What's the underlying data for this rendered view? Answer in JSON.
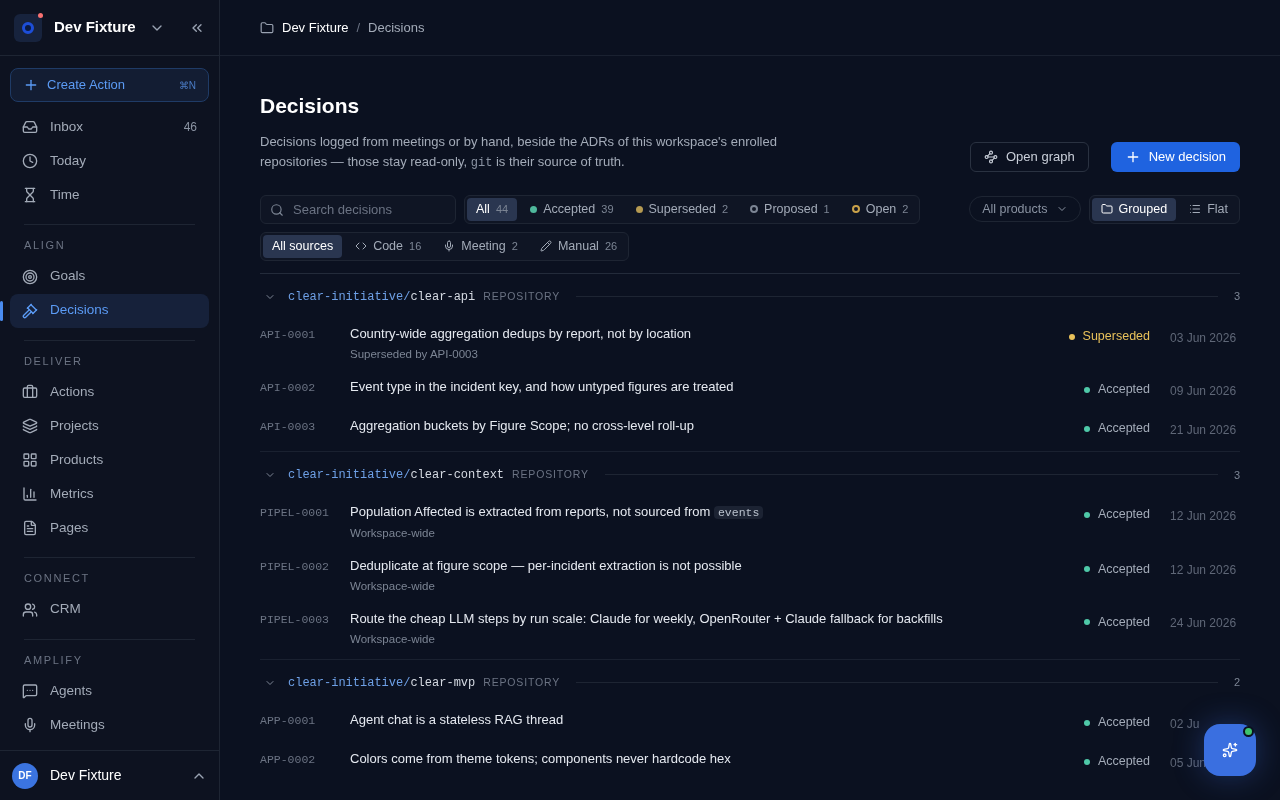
{
  "workspace": {
    "name": "Dev Fixture",
    "notification": true
  },
  "create_button": {
    "label": "Create Action",
    "shortcut": "⌘N"
  },
  "nav_top": [
    {
      "label": "Inbox",
      "count": "46",
      "selected": false
    },
    {
      "label": "Today",
      "selected": false
    },
    {
      "label": "Time",
      "selected": false
    }
  ],
  "nav_sections": [
    {
      "title": "ALIGN",
      "items": [
        {
          "label": "Goals",
          "selected": false
        },
        {
          "label": "Decisions",
          "selected": true
        }
      ]
    },
    {
      "title": "DELIVER",
      "items": [
        {
          "label": "Actions",
          "selected": false
        },
        {
          "label": "Projects",
          "selected": false
        },
        {
          "label": "Products",
          "selected": false
        },
        {
          "label": "Metrics",
          "selected": false
        },
        {
          "label": "Pages",
          "selected": false
        }
      ]
    },
    {
      "title": "CONNECT",
      "items": [
        {
          "label": "CRM",
          "selected": false
        }
      ]
    },
    {
      "title": "AMPLIFY",
      "items": [
        {
          "label": "Agents",
          "selected": false
        },
        {
          "label": "Meetings",
          "selected": false
        }
      ]
    }
  ],
  "user": {
    "initials": "DF",
    "name": "Dev Fixture"
  },
  "breadcrumb": [
    "Dev Fixture",
    "Decisions"
  ],
  "breadcrumb_separator": "/",
  "page": {
    "title": "Decisions",
    "desc_before": "Decisions logged from meetings or by hand, beside the ADRs of this workspace's enrolled repositories — those stay read-only, ",
    "desc_code": "git",
    "desc_after": " is their source of truth."
  },
  "actions": [
    {
      "kind": "secondary",
      "label": "Open graph"
    },
    {
      "kind": "primary",
      "label": "New decision"
    }
  ],
  "search": {
    "placeholder": "Search decisions"
  },
  "status_filters": [
    {
      "label": "All",
      "count": "44",
      "selected": true
    },
    {
      "kind": "filled",
      "label": "Accepted",
      "count": "39",
      "selected": false,
      "color": "#4fb89c"
    },
    {
      "kind": "filled",
      "label": "Superseded",
      "count": "2",
      "selected": false,
      "color": "#b59a52"
    },
    {
      "kind": "ring",
      "label": "Proposed",
      "count": "1",
      "selected": false,
      "color": "#7c8594"
    },
    {
      "kind": "ring",
      "label": "Open",
      "count": "2",
      "selected": false,
      "color": "#c9a24a"
    }
  ],
  "product_select": {
    "value": "All products"
  },
  "view_toggle": [
    {
      "label": "Grouped",
      "selected": true
    },
    {
      "label": "Flat",
      "selected": false
    }
  ],
  "source_filters": [
    {
      "label": "All sources",
      "selected": true
    },
    {
      "label": "Code",
      "count": "16",
      "selected": false
    },
    {
      "label": "Meeting",
      "count": "2",
      "selected": false
    },
    {
      "label": "Manual",
      "count": "26",
      "selected": false
    }
  ],
  "groups": [
    {
      "owner": "clear-initiative/",
      "repo": "clear-api",
      "tag": "REPOSITORY",
      "count": "3",
      "expanded": true,
      "rows": [
        {
          "id": "API-0001",
          "title": "Country-wide aggregation dedups by report, not by location",
          "subtitle": "Superseded by API-0003",
          "status": "Superseded",
          "kind": "superseded",
          "color": "#e8c15a",
          "date": "03 Jun 2026"
        },
        {
          "id": "API-0002",
          "title": "Event type in the incident key, and how untyped figures are treated",
          "status": "Accepted",
          "kind": "accepted",
          "color": "#4fc9a8",
          "date": "09 Jun 2026"
        },
        {
          "id": "API-0003",
          "title": "Aggregation buckets by Figure Scope; no cross-level roll-up",
          "status": "Accepted",
          "kind": "accepted",
          "color": "#4fc9a8",
          "date": "21 Jun 2026"
        }
      ]
    },
    {
      "owner": "clear-initiative/",
      "repo": "clear-context",
      "tag": "REPOSITORY",
      "count": "3",
      "expanded": true,
      "rows": [
        {
          "id": "PIPEL-0001",
          "title": "Population Affected is extracted from reports, not sourced from ",
          "title_code": "events",
          "subtitle": "Workspace-wide",
          "status": "Accepted",
          "kind": "accepted",
          "color": "#4fc9a8",
          "date": "12 Jun 2026"
        },
        {
          "id": "PIPEL-0002",
          "title": "Deduplicate at figure scope — per-incident extraction is not possible",
          "subtitle": "Workspace-wide",
          "status": "Accepted",
          "kind": "accepted",
          "color": "#4fc9a8",
          "date": "12 Jun 2026"
        },
        {
          "id": "PIPEL-0003",
          "title": "Route the cheap LLM steps by run scale: Claude for weekly, OpenRouter + Claude fallback for backfills",
          "subtitle": "Workspace-wide",
          "status": "Accepted",
          "kind": "accepted",
          "color": "#4fc9a8",
          "date": "24 Jun 2026"
        }
      ]
    },
    {
      "owner": "clear-initiative/",
      "repo": "clear-mvp",
      "tag": "REPOSITORY",
      "count": "2",
      "expanded": true,
      "rows": [
        {
          "id": "APP-0001",
          "title": "Agent chat is a stateless RAG thread",
          "status": "Accepted",
          "kind": "accepted",
          "color": "#4fc9a8",
          "date": "02 Ju"
        },
        {
          "id": "APP-0002",
          "title": "Colors come from theme tokens; components never hardcode hex",
          "status": "Accepted",
          "kind": "accepted",
          "color": "#4fc9a8",
          "date": "05 Jun"
        }
      ]
    }
  ],
  "assistant": {
    "online": true
  }
}
